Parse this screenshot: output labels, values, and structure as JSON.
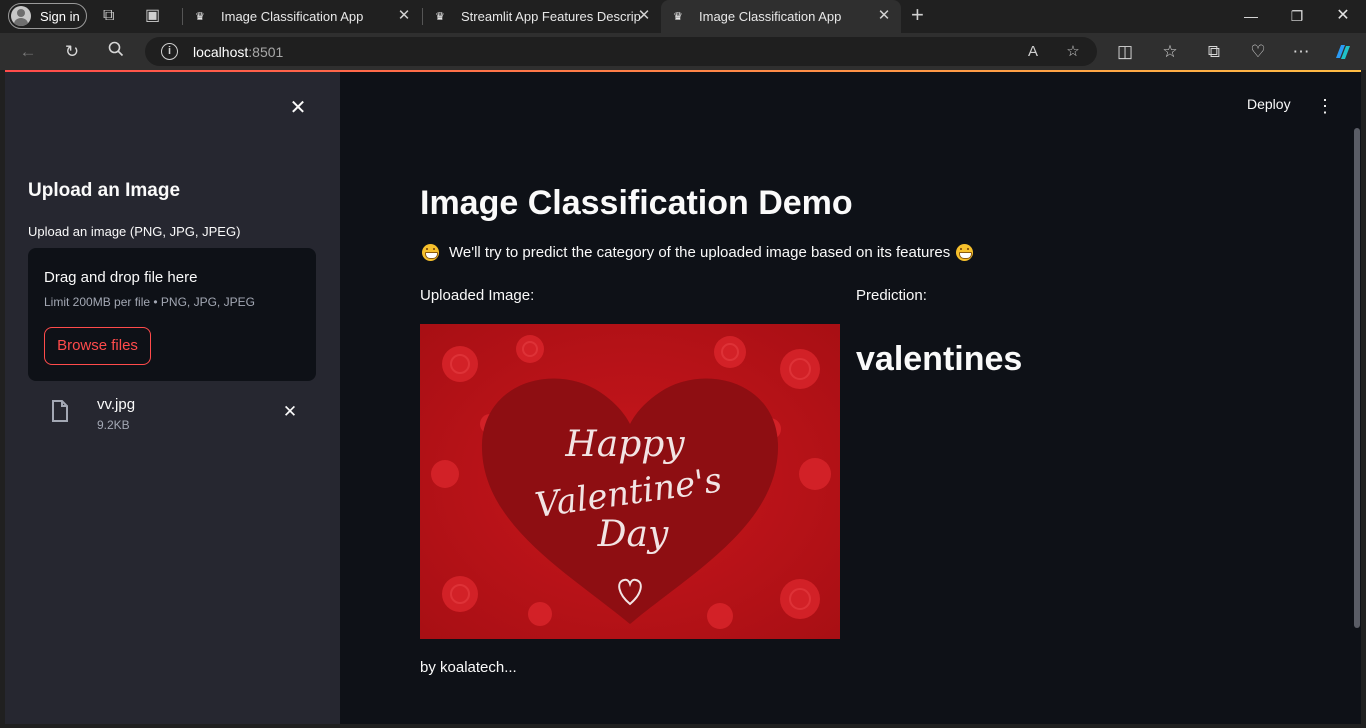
{
  "browser": {
    "signin_label": "Sign in",
    "tabs": [
      {
        "title": "Image Classification App",
        "active": false
      },
      {
        "title": "Streamlit App Features Description",
        "active": false
      },
      {
        "title": "Image Classification App",
        "active": true
      }
    ],
    "url_host": "localhost",
    "url_port": ":8501"
  },
  "sidebar": {
    "title": "Upload an Image",
    "uploader_label": "Upload an image (PNG, JPG, JPEG)",
    "dropzone_title": "Drag and drop file here",
    "dropzone_limit": "Limit 200MB per file • PNG, JPG, JPEG",
    "browse_label": "Browse files",
    "file": {
      "name": "vv.jpg",
      "size": "9.2KB"
    }
  },
  "header": {
    "deploy_label": "Deploy"
  },
  "main": {
    "title": "Image Classification Demo",
    "subtitle": "We'll try to predict the category of the uploaded image based on its features",
    "uploaded_label": "Uploaded Image:",
    "prediction_label": "Prediction:",
    "prediction_value": "valentines",
    "image_text": [
      "Happy",
      "Valentine's",
      "Day"
    ],
    "footer": "by koalatech..."
  },
  "colors": {
    "accent": "#ff4b4b",
    "app_bg": "#0e1117",
    "sidebar_bg": "#262730"
  }
}
